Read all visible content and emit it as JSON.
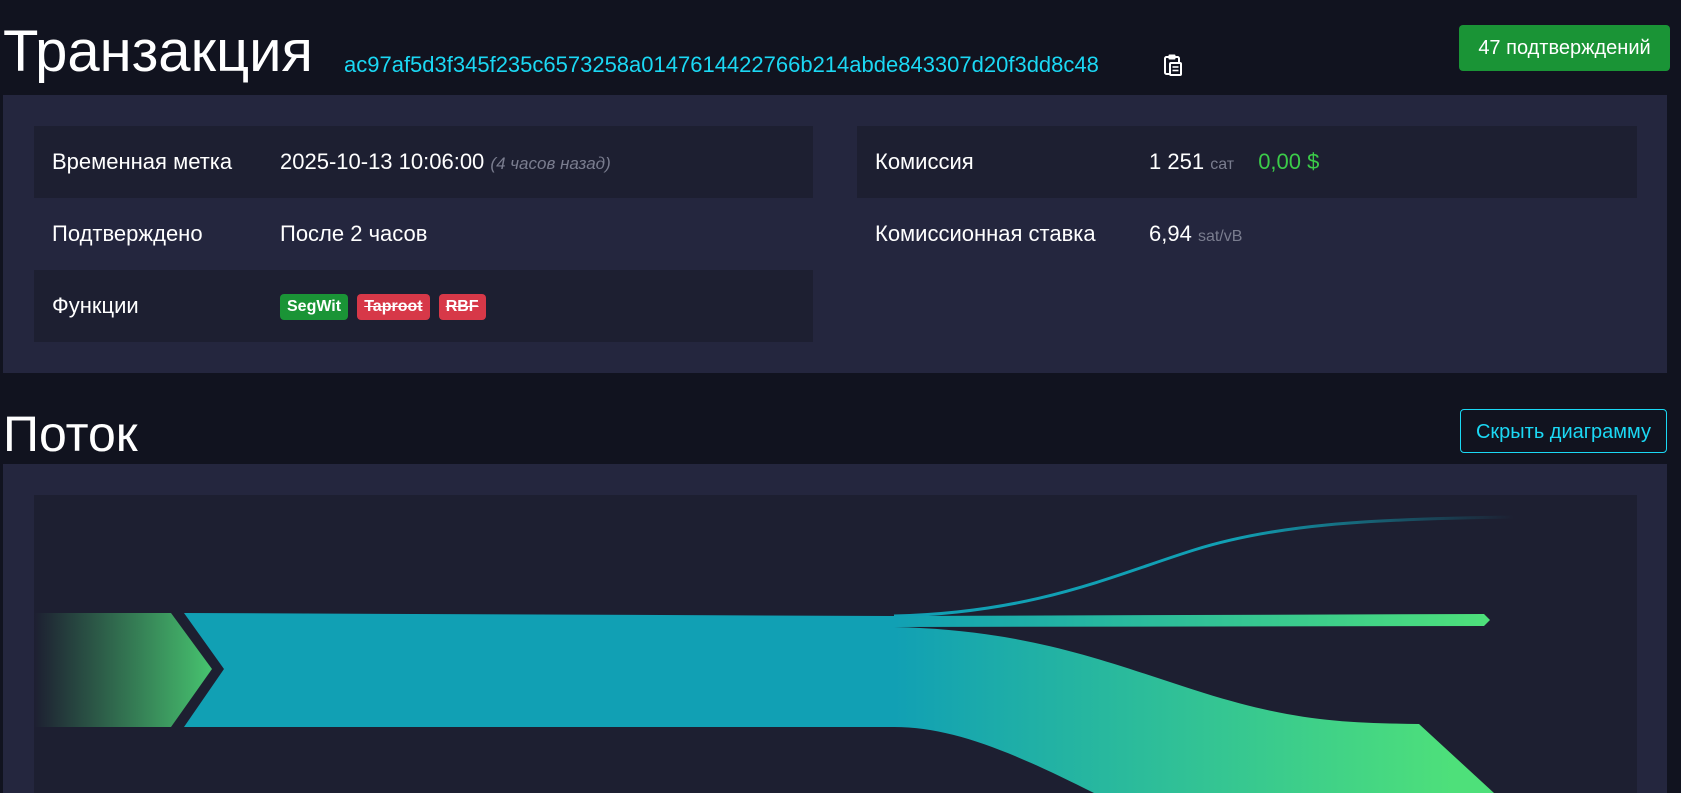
{
  "header": {
    "title": "Транзакция",
    "txid": "ac97af5d3f345f235c6573258a0147614422766b214abde843307d20f3dd8c48",
    "copy_icon": "clipboard-icon",
    "confirmations": "47 подтверждений"
  },
  "details": {
    "timestamp": {
      "label": "Временная метка",
      "value": "2025-10-13 10:06:00",
      "relative": "(4 часов назад)"
    },
    "confirmed": {
      "label": "Подтверждено",
      "value": "После 2 часов"
    },
    "features": {
      "label": "Функции",
      "badges": [
        "SegWit",
        "Taproot",
        "RBF"
      ]
    },
    "fee": {
      "label": "Комиссия",
      "value": "1 251",
      "unit": "сат",
      "fiat": "0,00 $"
    },
    "fee_rate": {
      "label": "Комиссионная ставка",
      "value": "6,94",
      "unit": "sat/vB"
    }
  },
  "flow": {
    "title": "Поток",
    "hide_button": "Скрыть диаграмму"
  },
  "colors": {
    "background": "#11131f",
    "panel": "#24263e",
    "row_stripe": "#1d1f31",
    "accent": "#1bd8f4",
    "success": "#1a9436",
    "danger": "#d73848",
    "flow_green": "#4ee07a",
    "flow_teal": "#11a0b4"
  }
}
